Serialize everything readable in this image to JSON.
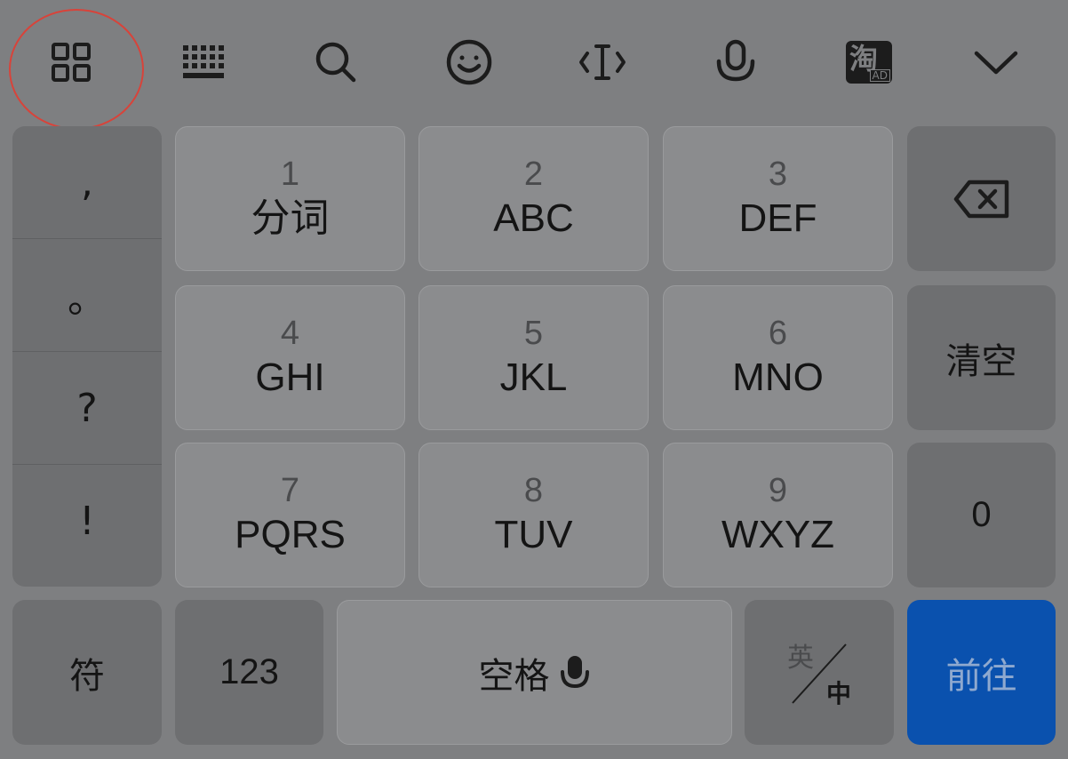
{
  "toolbar": {
    "items": [
      {
        "name": "grid-menu-icon"
      },
      {
        "name": "keyboard-layout-icon"
      },
      {
        "name": "search-icon"
      },
      {
        "name": "emoji-icon"
      },
      {
        "name": "cursor-edit-icon"
      },
      {
        "name": "microphone-icon"
      },
      {
        "name": "taobao-ad-icon",
        "glyph": "淘",
        "badge": "AD"
      },
      {
        "name": "collapse-chevron-icon"
      }
    ],
    "highlight_color": "#d8433a"
  },
  "punctuation": [
    ",",
    "。",
    "?",
    "!"
  ],
  "keys": [
    {
      "num": "1",
      "letters": "分词"
    },
    {
      "num": "2",
      "letters": "ABC"
    },
    {
      "num": "3",
      "letters": "DEF"
    },
    {
      "num": "4",
      "letters": "GHI"
    },
    {
      "num": "5",
      "letters": "JKL"
    },
    {
      "num": "6",
      "letters": "MNO"
    },
    {
      "num": "7",
      "letters": "PQRS"
    },
    {
      "num": "8",
      "letters": "TUV"
    },
    {
      "num": "9",
      "letters": "WXYZ"
    }
  ],
  "right_column": {
    "clear": "清空",
    "zero": "0"
  },
  "bottom_row": {
    "symbols": "符",
    "numbers": "123",
    "space": "空格",
    "lang_en": "英",
    "lang_zh": "中",
    "go": "前往"
  },
  "colors": {
    "background": "#7e7f81",
    "go_key": "#0a51ae"
  }
}
